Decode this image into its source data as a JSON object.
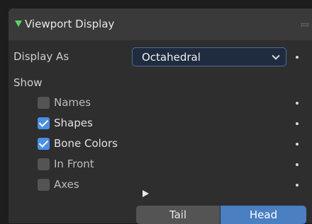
{
  "panel": {
    "title": "Viewport Display",
    "collapse_icon": "disclosure-triangle-down-icon",
    "grip_icon": "drag-grip-icon"
  },
  "display_as": {
    "label": "Display As",
    "value": "Octahedral"
  },
  "show": {
    "label": "Show",
    "options": [
      {
        "label": "Names",
        "checked": false
      },
      {
        "label": "Shapes",
        "checked": true
      },
      {
        "label": "Bone Colors",
        "checked": true
      },
      {
        "label": "In Front",
        "checked": false
      },
      {
        "label": "Axes",
        "checked": false
      }
    ]
  },
  "axes_position": {
    "options": [
      "Tail",
      "Head"
    ],
    "selected": "Head"
  },
  "colors": {
    "accent": "#4a90e2",
    "expand_arrow": "#57d66a",
    "selected_segment": "#4a7fc1"
  }
}
